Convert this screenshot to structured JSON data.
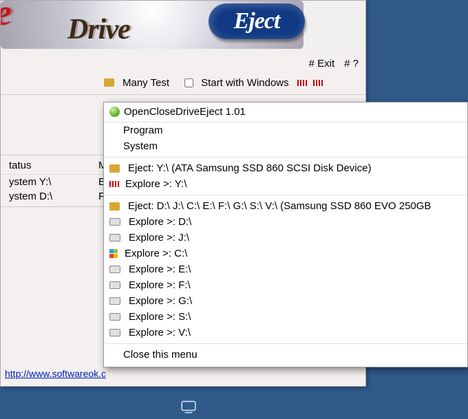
{
  "banner": {
    "ose_fragment": "ose",
    "drive_text": "Drive",
    "eject_text": "Eject"
  },
  "toolbar": {
    "exit": "# Exit",
    "help": "# ?"
  },
  "menu_row": {
    "menu_text_fragment": "Many  Test",
    "start_with_fragment": "Start with Windows"
  },
  "option": {
    "tray_checkbox_label": ""
  },
  "table": {
    "headers": {
      "status": "tatus",
      "media": "Media Ty"
    },
    "rows": [
      {
        "name": "ystem Y:\\",
        "media": "External"
      },
      {
        "name": "ystem D:\\",
        "media": "Fixed ha"
      }
    ]
  },
  "url": "http://www.softwareok.c",
  "popup": {
    "title": "OpenCloseDriveEject 1.01",
    "program": "Program",
    "system": "System",
    "eject_y": "Eject: Y:\\  (ATA Samsung SSD 860 SCSI Disk Device)",
    "explore_y": "Explore >: Y:\\",
    "eject_multi": "Eject: D:\\ J:\\ C:\\ E:\\ F:\\ G:\\ S:\\ V:\\  (Samsung SSD 860 EVO 250GB",
    "explore": [
      "Explore >: D:\\",
      "Explore >: J:\\",
      "Explore >: C:\\",
      "Explore >: E:\\",
      "Explore >: F:\\",
      "Explore >: G:\\",
      "Explore >: S:\\",
      "Explore >: V:\\"
    ],
    "close": "Close this menu"
  }
}
